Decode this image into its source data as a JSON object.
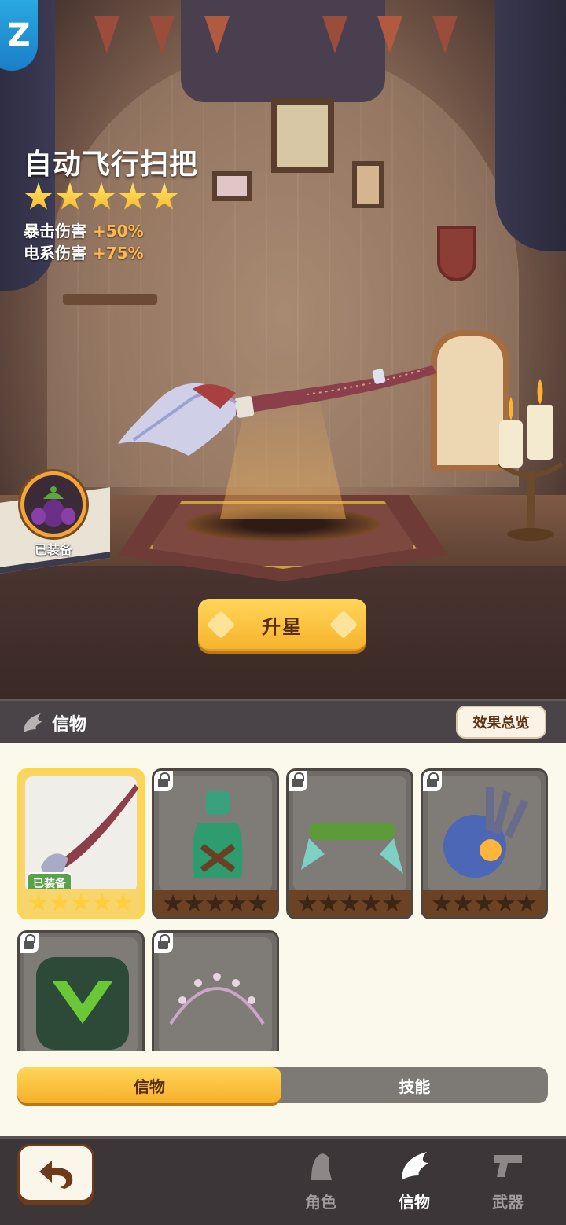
{
  "item": {
    "name": "自动飞行扫把",
    "stars": 5,
    "stats": [
      {
        "label": "暴击伤害",
        "value": "+50%"
      },
      {
        "label": "电系伤害",
        "value": "+75%"
      }
    ]
  },
  "equipped_badge_label": "已装备",
  "upgrade_button": "升星",
  "panel": {
    "title": "信物",
    "effect_button": "效果总览",
    "equipped_tag": "已装备",
    "cards": [
      {
        "name": "broom",
        "locked": false,
        "selected": true,
        "stars": 5
      },
      {
        "name": "potion",
        "locked": true,
        "stars": 0
      },
      {
        "name": "scroll",
        "locked": true,
        "stars": 0
      },
      {
        "name": "mech-glove",
        "locked": true,
        "stars": 0
      },
      {
        "name": "green-emblem",
        "locked": true
      },
      {
        "name": "flower-wreath",
        "locked": true
      }
    ]
  },
  "tabs": [
    "信物",
    "技能"
  ],
  "nav": [
    {
      "label": "角色",
      "active": false
    },
    {
      "label": "信物",
      "active": true
    },
    {
      "label": "武器",
      "active": false
    }
  ],
  "colors": {
    "accent": "#f7b22b",
    "stat_value": "#ffb84a",
    "equipped": "#58a24b"
  }
}
